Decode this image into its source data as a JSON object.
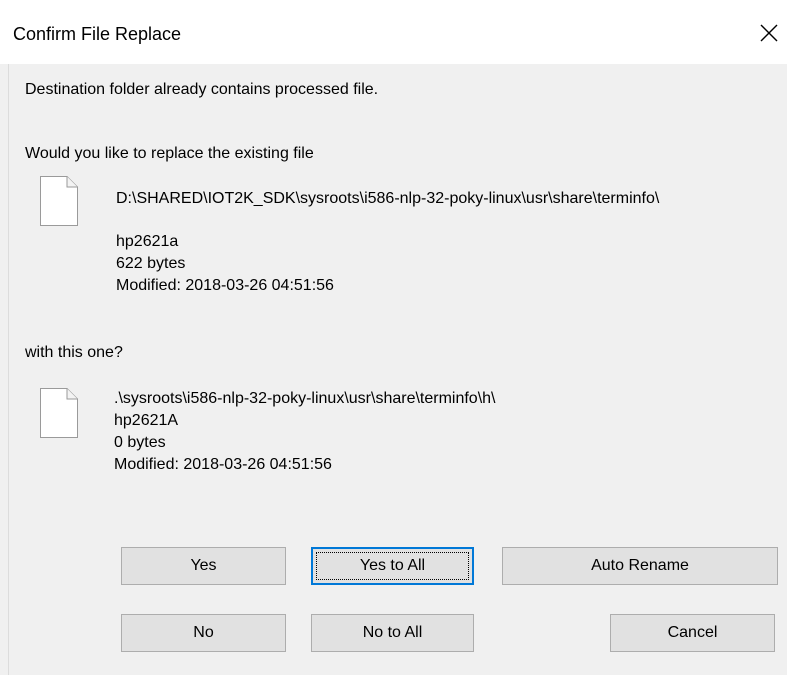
{
  "dialog": {
    "title": "Confirm File Replace",
    "close_label": "✕"
  },
  "message": {
    "line1": "Destination folder already contains processed file.",
    "line2": "Would you like to replace the existing file",
    "line3": "with this one?"
  },
  "existing_file": {
    "path": "D:\\SHARED\\IOT2K_SDK\\sysroots\\i586-nlp-32-poky-linux\\usr\\share\\terminfo\\",
    "name": "hp2621a",
    "size": "622 bytes",
    "modified": "Modified: 2018-03-26 04:51:56",
    "icon": "document-icon"
  },
  "new_file": {
    "path": ".\\sysroots\\i586-nlp-32-poky-linux\\usr\\share\\terminfo\\h\\",
    "name": "hp2621A",
    "size": "0 bytes",
    "modified": "Modified: 2018-03-26 04:51:56",
    "icon": "document-icon"
  },
  "buttons": {
    "yes": "Yes",
    "yes_to_all": "Yes to All",
    "auto_rename": "Auto Rename",
    "no": "No",
    "no_to_all": "No to All",
    "cancel": "Cancel"
  },
  "colors": {
    "accent": "#0078d7",
    "button_face": "#e1e1e1",
    "button_border": "#adadad",
    "client_bg": "#f0f0f0"
  }
}
